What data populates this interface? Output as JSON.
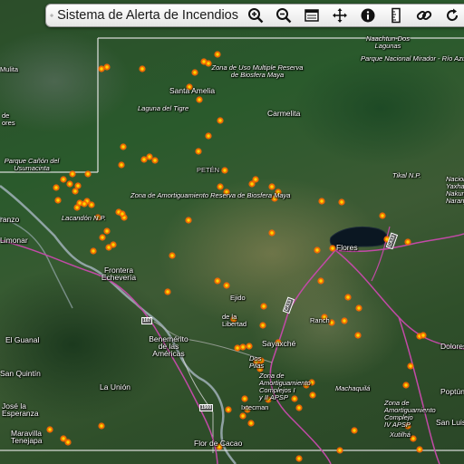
{
  "toolbar": {
    "title": "Sistema de Alerta de Incendios",
    "logo_icon": "gear-icon",
    "buttons": [
      {
        "name": "zoom-in-button",
        "icon": "zoom-in-icon"
      },
      {
        "name": "zoom-out-button",
        "icon": "zoom-out-icon"
      },
      {
        "name": "layers-button",
        "icon": "layers-icon"
      },
      {
        "name": "pan-button",
        "icon": "move-icon"
      },
      {
        "name": "info-button",
        "icon": "info-icon"
      },
      {
        "name": "measure-button",
        "icon": "ruler-icon"
      },
      {
        "name": "link-button",
        "icon": "link-icon"
      },
      {
        "name": "refresh-button",
        "icon": "refresh-icon"
      }
    ]
  },
  "map_labels": [
    {
      "id": "naachtun",
      "text": "Naachtun-Dos\nLagunas"
    },
    {
      "id": "mirador",
      "text": "Parque Nacional Mirador - Río Azul"
    },
    {
      "id": "multiple-use",
      "text": "Zona de Uso Multiple Reserva\nde Biosfera Maya"
    },
    {
      "id": "santa-amelia",
      "text": "Santa Amelia",
      "town": true
    },
    {
      "id": "carmelita",
      "text": "Carmelita",
      "town": true
    },
    {
      "id": "laguna-tigre",
      "text": "Laguna del Tigre"
    },
    {
      "id": "peten",
      "text": "PETÉN"
    },
    {
      "id": "tikal",
      "text": "Tikal N.P."
    },
    {
      "id": "nacional",
      "text": "Nacional\nYaxha\nNakum\nNaranjo"
    },
    {
      "id": "buffer-zone",
      "text": "Zona de Amortiguamiento Reserva de Biosfera Maya"
    },
    {
      "id": "canon",
      "text": "Parque Cañón del\nUsumacinta"
    },
    {
      "id": "lacandon",
      "text": "Lacandón N.P."
    },
    {
      "id": "mulita",
      "text": "Mulita"
    },
    {
      "id": "de-ores",
      "text": "de\nores"
    },
    {
      "id": "flores",
      "text": "Flores",
      "town": true
    },
    {
      "id": "frontera",
      "text": "Frontera\nEchevería",
      "town": true
    },
    {
      "id": "ranzo",
      "text": "ranzo",
      "town": true
    },
    {
      "id": "limonar",
      "text": "Limonar",
      "town": true
    },
    {
      "id": "benemerito",
      "text": "Benemérito\nde las\nAméricas",
      "town": true
    },
    {
      "id": "el-guanal",
      "text": "El Guanal",
      "town": true
    },
    {
      "id": "san-quintin",
      "text": "San Quintín",
      "town": true
    },
    {
      "id": "la-union",
      "text": "La Unión",
      "town": true
    },
    {
      "id": "jose-esperanza",
      "text": "José la\nEsperanza",
      "town": true
    },
    {
      "id": "maravilla",
      "text": "Maravilla\nTenejapa",
      "town": true
    },
    {
      "id": "flor-de-cacao",
      "text": "Flor de Cacao",
      "town": true
    },
    {
      "id": "sayaxche",
      "text": "Sayaxché",
      "town": true
    },
    {
      "id": "la-lib",
      "text": "de la\nLibertad"
    },
    {
      "id": "dos-pilas",
      "text": "Dos\nPilas"
    },
    {
      "id": "rancho",
      "text": "Ranch"
    },
    {
      "id": "zona-complejo",
      "text": "Zona de\nAmortiguamiento\nComplejos I\ny II APSP"
    },
    {
      "id": "machaquila",
      "text": "Machaquilá"
    },
    {
      "id": "poptun",
      "text": "Poptún",
      "town": true
    },
    {
      "id": "dolores",
      "text": "Dolores",
      "town": true
    },
    {
      "id": "san-luis",
      "text": "San Luis",
      "town": true
    },
    {
      "id": "zona-iv",
      "text": "Zona de\nAmortiguamiento\nComplejo\nIV APSP"
    },
    {
      "id": "xutilha",
      "text": "Xutilhá"
    },
    {
      "id": "sayaman",
      "text": "Ixtecman"
    },
    {
      "id": "ejido",
      "text": "Ejido"
    }
  ],
  "highway_shields": [
    "107",
    "1900",
    "CA13",
    "CA13"
  ],
  "fire_alert_count": 103,
  "colors": {
    "fire_outer": "#ff6a00",
    "fire_inner": "#ffd400",
    "road": "#c24aa7",
    "border": "#e8e8e8"
  }
}
